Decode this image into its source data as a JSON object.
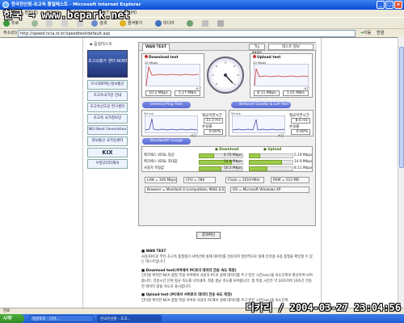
{
  "window": {
    "title": "한국전산원-초고속 품질테스트 - Microsoft Internet Explorer"
  },
  "watermark": "한국 → www.bcpark.net",
  "menu": [
    "파일(F)",
    "편집(E)",
    "보기(V)",
    "즐겨찾기(A)",
    "도구(T)",
    "도움말(H)"
  ],
  "toolbar": {
    "back": "뒤로",
    "search": "검색",
    "favorites": "즐겨찾기",
    "media": "미디어"
  },
  "address": {
    "label": "주소(D)",
    "url": "http://speed.ncia.or.kr/speedtest/default.asp",
    "go": "이동",
    "links": "연결"
  },
  "page": {
    "crumb": "품질테스트",
    "sidebar": {
      "banner": "초고속평가 센터 NORTH",
      "items": [
        "IT시대로여는정보통신",
        "초고속국가망 안내",
        "초고속선도망 연구센터",
        "초고속 국가정보망",
        "NGI Next Generation",
        "정보통신 국가망센터",
        "KIX",
        "우병고리터해서"
      ]
    },
    "panel": {
      "tab": "WAN TEST",
      "try_again": "Try again",
      "test_info": "테스트 정보",
      "download": {
        "label": "Download test",
        "max": "20 Mbps",
        "time": "시간",
        "mbps": "10.2 Mbps",
        "mbs": "1.27 MB/s"
      },
      "upload": {
        "label": "Upload test",
        "max": "20 Mbps",
        "time": "시간",
        "mbps": "8.11 Mbps",
        "mbs": "1.01 MB/s"
      },
      "ping_section": "General Ping Test",
      "net_section": "Network Quality & LoP Test",
      "ping_left": {
        "max": "50 ms",
        "time": "시간",
        "avg_label": "평균지연시간",
        "avg": "11.3 ms",
        "loss_label": "손실률",
        "loss": "0.00%"
      },
      "ping_right": {
        "max": "50 ms",
        "time": "시간",
        "avg_label": "평균지연시간",
        "avg": "8.6 ms",
        "loss_label": "손실률",
        "loss": "0.00%"
      },
      "bandwidth_section": "Bandwidth Gauge",
      "results": {
        "headers": {
          "download": "Download",
          "upload": "Upload"
        },
        "rows": [
          {
            "label": "메가패스 VDSL 평균",
            "down": "6.70 Mbps",
            "up": "5.19 Mbps",
            "down_frac": 0.34,
            "up_frac": 0.26
          },
          {
            "label": "메가패스 VDSL 최대값",
            "down": "14.9 Mbps",
            "up": "14.9 Mbps",
            "down_frac": 0.75,
            "up_frac": 0.75
          },
          {
            "label": "사용자 측정값",
            "down": "10.2 Mbps",
            "up": "8.11 Mbps",
            "down_frac": 0.51,
            "up_frac": 0.41
          }
        ]
      },
      "system": {
        "lan": "LAN = 100 Mbps",
        "cpu": "CPU = 586",
        "clock": "Clock = 2019 MHz",
        "ram": "RAM = 512 MB",
        "browser": "Browser = Mozilla/4.0 (compatible; MSIE 6.0",
        "os": "OS = Microsoft Windows XP"
      }
    },
    "result_button": "결과확인",
    "desc": {
      "wan_title": "WAN TEST",
      "wan_text": "사용자PC로 부터 초고속 품질평가 서버간에 실제 데이터를 전송하여 일반적으로 실제 인터넷 사용 품질을 확인할 수 있는 테스트입니다.",
      "down_title": "Download test(서버에서 PC로의 데이터 전송 속도 측정)",
      "down_text": "인터넷 위지한 NCA 품질 측정 서버에서 사용자 PC로 실제 데이터를 주고 받은 시간(sec)을 속도단위로 환산하여 보여줍니다. 전송시간 단위 평균 속도를 나타내며, 최종 평균 속도를 보여줍니다. 총 측정 시간은 약 10초이며 10초간 전송한 데이터 량을 속도로 표시합니다.",
      "up_title": "Upload test (PC에서 서버로의 데이터 전송 속도 측정)",
      "up_text": "인터넷 위지한 NCA 품질 측정 서버로 사용자 PC에서 실제 데이터를 주고 받은 시간(sec)을 속도단위"
    }
  },
  "status": {
    "text": "완료"
  },
  "stamp": "디카리 / 2004-03-27 23:04:56",
  "taskbar": {
    "start": "시작",
    "tasks": [
      "파랑포토 - 디카...",
      "한국전산원 - 초고..."
    ]
  }
}
